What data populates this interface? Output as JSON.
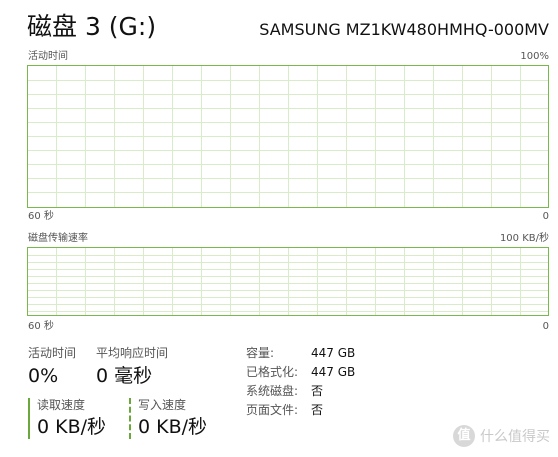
{
  "header": {
    "title": "磁盘 3 (G:)",
    "model": "SAMSUNG MZ1KW480HMHQ-000MV"
  },
  "graph_activity": {
    "label": "活动时间",
    "max_label": "100%",
    "time_label": "60 秒",
    "min_label": "0"
  },
  "graph_transfer": {
    "label": "磁盘传输速率",
    "max_label": "100 KB/秒",
    "time_label": "60 秒",
    "min_label": "0"
  },
  "stats": {
    "active_time_label": "活动时间",
    "active_time_value": "0%",
    "response_label": "平均响应时间",
    "response_value": "0 毫秒",
    "read_label": "读取速度",
    "read_value": "0 KB/秒",
    "write_label": "写入速度",
    "write_value": "0 KB/秒"
  },
  "details": {
    "capacity_label": "容量:",
    "capacity_value": "447 GB",
    "formatted_label": "已格式化:",
    "formatted_value": "447 GB",
    "system_disk_label": "系统磁盘:",
    "system_disk_value": "否",
    "pagefile_label": "页面文件:",
    "pagefile_value": "否"
  },
  "watermark": {
    "icon_text": "值",
    "text": "什么值得买"
  },
  "colors": {
    "graph_border": "#79b84a",
    "grid_line": "#d9ecc9",
    "accent": "#6aa83b"
  }
}
